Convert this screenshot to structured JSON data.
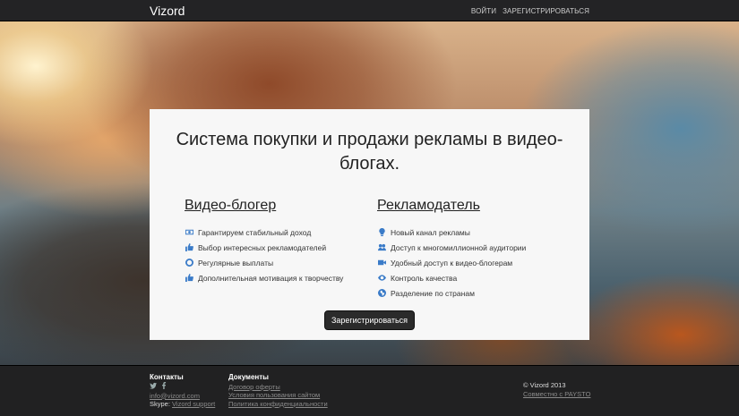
{
  "navbar": {
    "brand": "Vizord",
    "links": [
      "ВОЙТИ",
      "ЗАРЕГИСТРИРОВАТЬСЯ"
    ]
  },
  "hero": {
    "title": "Система покупки и продажи рекламы в видео-блогах.",
    "left_column": {
      "heading": "Видео-блогер",
      "items": [
        {
          "icon": "money-icon",
          "text": "Гарантируем стабильный доход"
        },
        {
          "icon": "thumbs-up-icon",
          "text": "Выбор интересных рекламодателей"
        },
        {
          "icon": "circle-icon",
          "text": "Регулярные выплаты"
        },
        {
          "icon": "thumbs-up-icon",
          "text": "Дополнительная мотивация к творчеству"
        }
      ]
    },
    "right_column": {
      "heading": "Рекламодатель",
      "items": [
        {
          "icon": "lightbulb-icon",
          "text": "Новый канал рекламы"
        },
        {
          "icon": "users-icon",
          "text": "Доступ к многомиллионной аудитории"
        },
        {
          "icon": "video-camera-icon",
          "text": "Удобный доступ к видео-блогерам"
        },
        {
          "icon": "eye-icon",
          "text": "Контроль качества"
        },
        {
          "icon": "globe-icon",
          "text": "Разделение по странам"
        }
      ]
    },
    "cta_label": "Зарегистрироваться"
  },
  "footer": {
    "contacts": {
      "heading": "Контакты",
      "social": [
        "twitter-icon",
        "facebook-icon"
      ],
      "email": "info@vizord.com",
      "skype_label": "Skype:",
      "skype_link": "Vizord support"
    },
    "documents": {
      "heading": "Документы",
      "links": [
        "Договор оферты",
        "Условия пользования сайтом",
        "Политика конфиденциальности"
      ]
    },
    "copyright": "© Vizord 2013",
    "partner_link": "Совместно с PAYSTO"
  },
  "colors": {
    "accent_icon": "#3a7bc8",
    "navbar_bg": "#232325",
    "footer_bg": "#212122",
    "cta_bg": "#2b2b2b"
  }
}
